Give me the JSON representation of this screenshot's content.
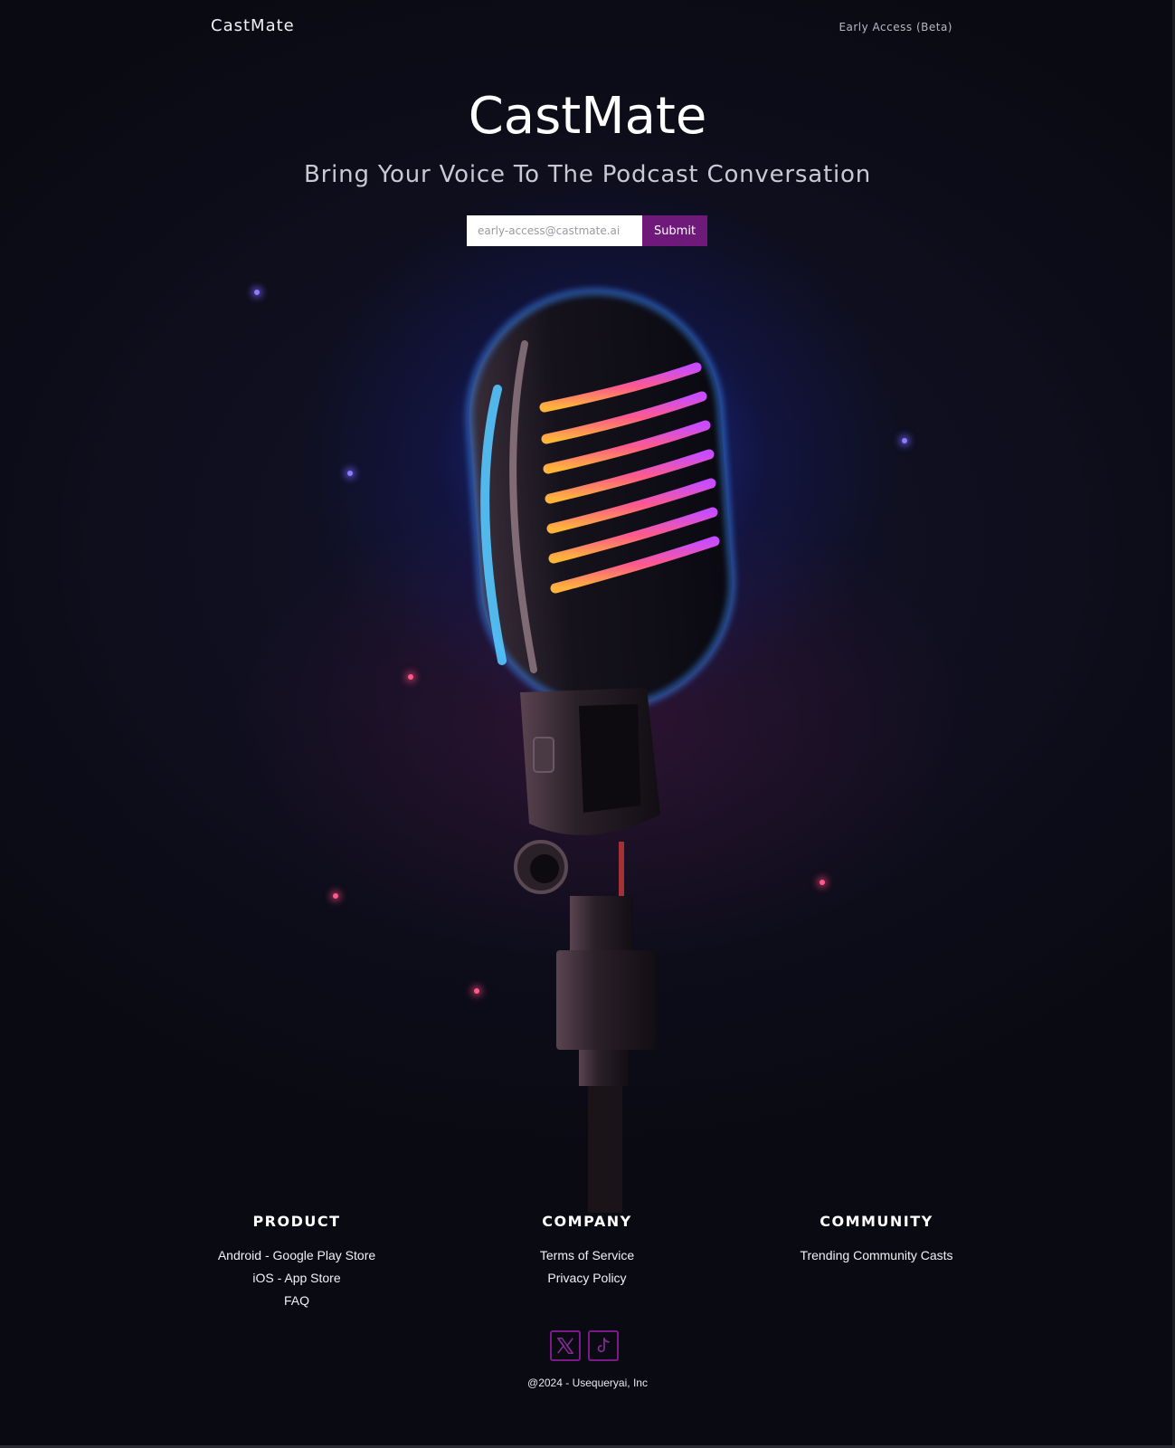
{
  "topbar": {
    "logo": "CastMate",
    "beta_link": "Early Access (Beta)"
  },
  "hero": {
    "title": "CastMate",
    "subtitle": "Bring Your Voice To The Podcast Conversation",
    "email_placeholder": "early-access@castmate.ai",
    "submit_label": "Submit"
  },
  "footer": {
    "columns": [
      {
        "heading": "PRODUCT",
        "links": [
          "Android - Google Play Store",
          "iOS - App Store",
          "FAQ"
        ]
      },
      {
        "heading": "COMPANY",
        "links": [
          "Terms of Service",
          "Privacy Policy"
        ]
      },
      {
        "heading": "COMMUNITY",
        "links": [
          "Trending Community Casts"
        ]
      }
    ],
    "socials": [
      "x-icon",
      "tiktok-icon"
    ],
    "copyright": "@2024 - Usequeryai, Inc"
  },
  "colors": {
    "background": "#0c0b14",
    "accent": "#6f1a7a",
    "glow_blue": "#2846ff"
  }
}
